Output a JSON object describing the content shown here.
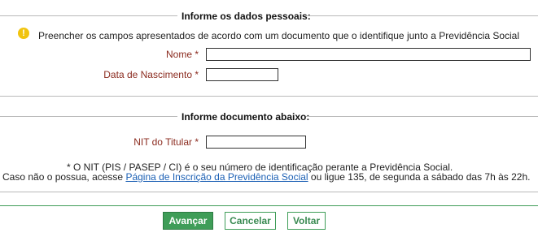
{
  "personal_section": {
    "title": "Informe os dados pessoais:",
    "info_icon": "exclamation-icon",
    "info_text": "Preencher os campos apresentados de acordo com um documento que o identifique junto a Previdência Social",
    "name_label": "Nome *",
    "name_value": "",
    "birth_label": "Data de Nascimento *",
    "birth_value": ""
  },
  "document_section": {
    "title": "Informe documento abaixo:",
    "nit_label": "NIT do Titular *",
    "nit_value": "",
    "note_line1": "* O NIT (PIS / PASEP / CI) é o seu número de identificação perante a Previdência Social.",
    "note_line2_prefix": "Caso não o possua, acesse ",
    "note_link": "Página de Inscrição da Previdência Social",
    "note_line2_suffix": " ou ligue 135, de segunda a sábado das 7h às 22h."
  },
  "actions": {
    "advance": "Avançar",
    "cancel": "Cancelar",
    "back": "Voltar"
  },
  "colors": {
    "label": "#8b2b1f",
    "primary_button": "#3f9d58",
    "warning_icon": "#f1c40f",
    "link": "#1a5fb4"
  }
}
